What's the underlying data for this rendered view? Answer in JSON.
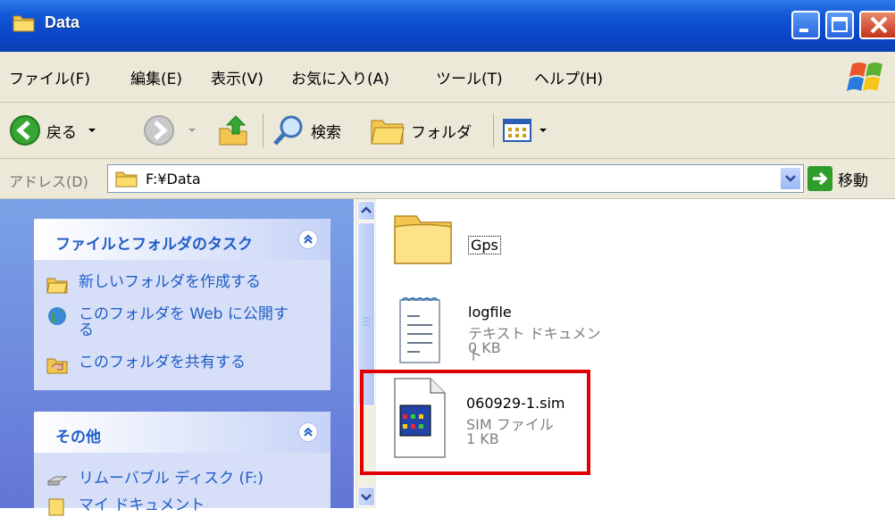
{
  "window": {
    "title": "Data",
    "colors": {
      "titlebar": "#0a46c8",
      "close": "#c6321a",
      "accent_link": "#215dc6",
      "highlight": "#e00000"
    }
  },
  "menu": {
    "items": [
      {
        "label": "ファイル(F)"
      },
      {
        "label": "編集(E)"
      },
      {
        "label": "表示(V)"
      },
      {
        "label": "お気に入り(A)"
      },
      {
        "label": "ツール(T)"
      },
      {
        "label": "ヘルプ(H)"
      }
    ]
  },
  "toolbar": {
    "back_label": "戻る",
    "search_label": "検索",
    "folders_label": "フォルダ"
  },
  "address": {
    "label": "アドレス(D)",
    "value": "F:¥Data",
    "go_label": "移動"
  },
  "taskpane": {
    "file_tasks": {
      "title": "ファイルとフォルダのタスク",
      "items": [
        {
          "label": "新しいフォルダを作成する",
          "icon": "new-folder-icon"
        },
        {
          "label": "このフォルダを Web に公開する",
          "icon": "publish-web-icon"
        },
        {
          "label": "このフォルダを共有する",
          "icon": "share-folder-icon"
        }
      ]
    },
    "other": {
      "title": "その他",
      "items": [
        {
          "label": "リムーバブル ディスク (F:)",
          "icon": "removable-disk-icon"
        },
        {
          "label": "マイ ドキュメント",
          "icon": "my-documents-icon"
        }
      ]
    }
  },
  "files": [
    {
      "name": "Gps",
      "type": "",
      "size": "",
      "icon": "folder-icon"
    },
    {
      "name": "logfile",
      "type": "テキスト ドキュメント",
      "size": "0 KB",
      "icon": "text-document-icon"
    },
    {
      "name": "060929-1.sim",
      "type": "SIM ファイル",
      "size": "1 KB",
      "icon": "sim-file-icon"
    }
  ]
}
